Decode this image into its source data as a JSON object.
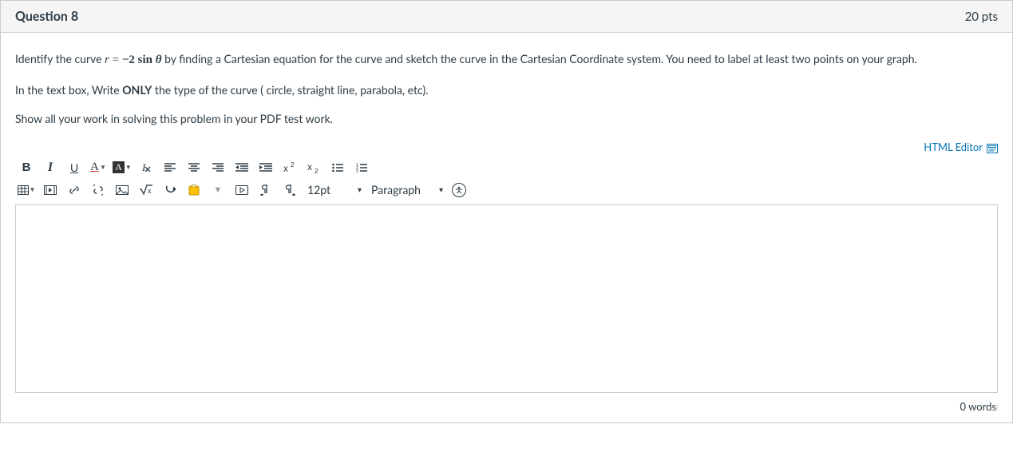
{
  "header": {
    "title": "Question 8",
    "points": "20 pts"
  },
  "instructions": {
    "line1_pre": "Identify the curve ",
    "line1_math_r": "r",
    "line1_math_eq": " = ",
    "line1_math_neg": "−",
    "line1_math_coef": "2 sin ",
    "line1_math_theta": "θ",
    "line1_post": " by finding a Cartesian equation for the curve and sketch the curve in the Cartesian Coordinate system. You need to label at least two points on your graph.",
    "line2_pre": "In the text box, Write ",
    "line2_bold": "ONLY",
    "line2_post": " the type of the curve ( circle, straight line, parabola, etc).",
    "line3": "Show all your work in solving this problem in your PDF test work."
  },
  "editor": {
    "html_editor_label": "HTML Editor",
    "font_size": "12pt",
    "paragraph": "Paragraph",
    "word_count": "0 words"
  }
}
